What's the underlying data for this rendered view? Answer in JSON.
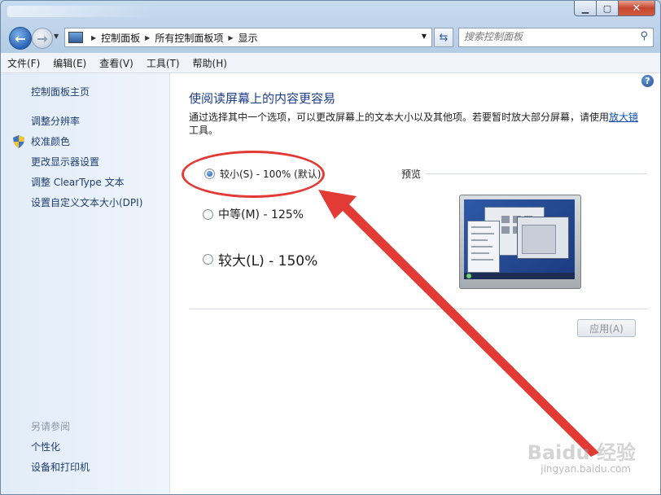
{
  "navbar": {
    "breadcrumbs": [
      "控制面板",
      "所有控制面板项",
      "显示"
    ],
    "search_placeholder": "搜索控制面板"
  },
  "menubar": {
    "items": [
      "文件(F)",
      "编辑(E)",
      "查看(V)",
      "工具(T)",
      "帮助(H)"
    ]
  },
  "sidebar": {
    "home": "控制面板主页",
    "links": [
      "调整分辨率",
      "校准颜色",
      "更改显示器设置",
      "调整 ClearType 文本",
      "设置自定义文本大小(DPI)"
    ],
    "see_also_title": "另请参阅",
    "see_also": [
      "个性化",
      "设备和打印机"
    ]
  },
  "main": {
    "heading": "使阅读屏幕上的内容更容易",
    "description_prefix": "通过选择其中一个选项，可以更改屏幕上的文本大小以及其他项。若要暂时放大部分屏幕，请使用",
    "magnifier_link": "放大镜",
    "description_suffix": "工具。",
    "options": [
      {
        "label": "较小(S) - 100% (默认)",
        "selected": true
      },
      {
        "label": "中等(M) - 125%",
        "selected": false
      },
      {
        "label": "较大(L) - 150%",
        "selected": false
      }
    ],
    "preview_label": "预览",
    "apply_label": "应用(A)"
  },
  "watermark": {
    "text": "Baidu 经验",
    "sub": "jingyan.baidu.com"
  },
  "colors": {
    "annotation": "#e23b36",
    "link": "#0a4fb5",
    "heading": "#1e3e8c"
  }
}
